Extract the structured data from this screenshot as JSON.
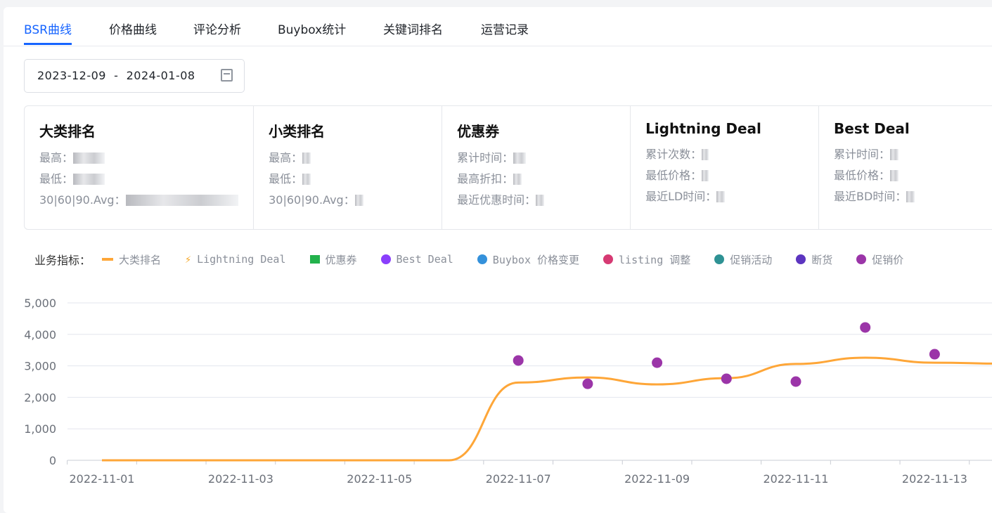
{
  "tabs": [
    "BSR曲线",
    "价格曲线",
    "评论分析",
    "Buybox统计",
    "关键词排名",
    "运营记录"
  ],
  "date_range": "2023-12-09  -  2024-01-08",
  "cards": [
    {
      "title": "大类排名",
      "rows": [
        "最高：",
        "最低：",
        "30|60|90.Avg："
      ]
    },
    {
      "title": "小类排名",
      "rows": [
        "最高：",
        "最低：",
        "30|60|90.Avg："
      ]
    },
    {
      "title": "优惠券",
      "rows": [
        "累计时间：",
        "最高折扣：",
        "最近优惠时间："
      ]
    },
    {
      "title": "Lightning Deal",
      "rows": [
        "累计次数：",
        "最低价格：",
        "最近LD时间："
      ]
    },
    {
      "title": "Best Deal",
      "rows": [
        "累计时间：",
        "最低价格：",
        "最近BD时间："
      ]
    }
  ],
  "legend": {
    "title": "业务指标：",
    "items": [
      {
        "label": "大类排名",
        "icon": "line",
        "color": "#fea638"
      },
      {
        "label": "Lightning Deal",
        "icon": "bolt",
        "color": "#f5a623"
      },
      {
        "label": "优惠券",
        "icon": "coupon",
        "color": "#22b24c"
      },
      {
        "label": "Best Deal",
        "icon": "dot",
        "color": "#8a3ffc"
      },
      {
        "label": "Buybox 价格变更",
        "icon": "dot",
        "color": "#3491db"
      },
      {
        "label": "listing 调整",
        "icon": "dot",
        "color": "#d63a73"
      },
      {
        "label": "促销活动",
        "icon": "dot",
        "color": "#2e9294"
      },
      {
        "label": "断货",
        "icon": "dot",
        "color": "#5c35c0"
      },
      {
        "label": "促销价",
        "icon": "dot",
        "color": "#9b35a8"
      }
    ]
  },
  "chart_data": {
    "type": "line",
    "categories": [
      "2022-11-01",
      "2022-11-02",
      "2022-11-03",
      "2022-11-04",
      "2022-11-05",
      "2022-11-06",
      "2022-11-07",
      "2022-11-08",
      "2022-11-09",
      "2022-11-10",
      "2022-11-11",
      "2022-11-12",
      "2022-11-13",
      "2022-11-14"
    ],
    "x_tick_labels": [
      "2022-11-01",
      "2022-11-03",
      "2022-11-05",
      "2022-11-07",
      "2022-11-09",
      "2022-11-11",
      "2022-11-13"
    ],
    "ylim": [
      0,
      5000
    ],
    "y_ticks": [
      "0",
      "1,000",
      "2,000",
      "3,000",
      "4,000",
      "5,000"
    ],
    "grid": true,
    "series": [
      {
        "name": "大类排名",
        "type": "line",
        "color": "#fea638",
        "values": [
          0,
          0,
          0,
          0,
          0,
          0,
          2470,
          2630,
          2410,
          2610,
          3060,
          3260,
          3100,
          3070
        ]
      },
      {
        "name": "促销价",
        "type": "scatter",
        "color": "#9b35a8",
        "points": [
          [
            "2022-11-07",
            3170
          ],
          [
            "2022-11-08",
            2430
          ],
          [
            "2022-11-09",
            3100
          ],
          [
            "2022-11-10",
            2590
          ],
          [
            "2022-11-11",
            2500
          ],
          [
            "2022-11-12",
            4220
          ],
          [
            "2022-11-13",
            3370
          ]
        ]
      }
    ]
  }
}
